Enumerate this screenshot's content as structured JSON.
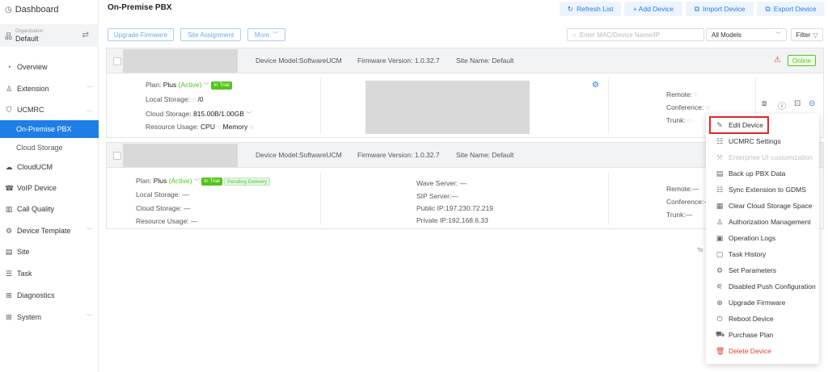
{
  "sidebar": {
    "dashboard": "Dashboard",
    "org_label": "Organization",
    "org_value": "Default",
    "items": [
      {
        "label": "Overview",
        "icon": "clock-icon"
      },
      {
        "label": "Extension",
        "icon": "user-icon"
      },
      {
        "label": "UCMRC",
        "icon": "shield-icon"
      },
      {
        "label": "On-Premise PBX"
      },
      {
        "label": "Cloud Storage"
      },
      {
        "label": "CloudUCM",
        "icon": "cloud-icon"
      },
      {
        "label": "VoIP Device",
        "icon": "phone-icon"
      },
      {
        "label": "Call Quality",
        "icon": "bar-chart-icon"
      },
      {
        "label": "Device Template",
        "icon": "template-icon"
      },
      {
        "label": "Site",
        "icon": "site-icon"
      },
      {
        "label": "Task",
        "icon": "task-icon"
      },
      {
        "label": "Diagnostics",
        "icon": "diagnostics-icon"
      },
      {
        "label": "System",
        "icon": "system-icon"
      }
    ]
  },
  "header": {
    "title": "On-Premise PBX",
    "refresh": "Refresh List",
    "add": "+ Add Device",
    "import": "Import Device",
    "export": "Export Device"
  },
  "toolbar": {
    "upgrade": "Upgrade Firmware",
    "site": "Site Assignment",
    "more": "More",
    "search_placeholder": "Enter MAC/Device Name/IP",
    "models": "All Models",
    "filter": "Filter"
  },
  "devices": [
    {
      "model": "Device Model:SoftwareUCM",
      "firmware": "Firmware Version: 1.0.32.7",
      "site": "Site Name: Default",
      "status": "Online",
      "plan_label": "Plan:",
      "plan_value": "Plus",
      "plan_state": "(Active)",
      "trial": "In Trial",
      "local_storage": "Local Storage:",
      "local_value": "/0",
      "cloud_storage": "Cloud Storage:",
      "cloud_value": "815.00B/1.00GB",
      "resource": "Resource Usage:",
      "cpu": "CPU",
      "memory": "Memory",
      "remote": "Remote:",
      "conference": "Conference:",
      "trunk": "Trunk:"
    },
    {
      "model": "Device Model:SoftwareUCM",
      "firmware": "Firmware Version: 1.0.32.7",
      "site": "Site Name: Default",
      "plan_label": "Plan:",
      "plan_value": "Plus",
      "plan_state": "(Active)",
      "trial": "In Trial",
      "pending": "Pending Delivery",
      "local_storage": "Local Storage: —",
      "cloud_storage": "Cloud Storage: —",
      "resource": "Resource Usage: —",
      "wave": "Wave Server: —",
      "sip": "SIP Server:—",
      "public_ip": "Public IP:197.230.72.219",
      "private_ip": "Private IP:192.168.6.33",
      "remote": "Remote:—",
      "conference": "Conference:—",
      "trunk": "Trunk:—"
    }
  ],
  "total_label": "To",
  "menu": [
    {
      "label": "Edit Device",
      "icon": "edit-icon"
    },
    {
      "label": "UCMRC Settings",
      "icon": "settings-sliders-icon"
    },
    {
      "label": "Enterprise UI customization",
      "icon": "ui-customize-icon",
      "disabled": true
    },
    {
      "label": "Back up PBX Data",
      "icon": "backup-icon"
    },
    {
      "label": "Sync Extension to GDMS",
      "icon": "sync-icon"
    },
    {
      "label": "Clear Cloud Storage Space",
      "icon": "clear-storage-icon"
    },
    {
      "label": "Authorization Management",
      "icon": "user-key-icon"
    },
    {
      "label": "Operation Logs",
      "icon": "log-icon"
    },
    {
      "label": "Task History",
      "icon": "history-icon"
    },
    {
      "label": "Set Parameters",
      "icon": "gear-icon"
    },
    {
      "label": "Disabled Push Configuration",
      "icon": "push-icon"
    },
    {
      "label": "Upgrade Firmware",
      "icon": "upgrade-icon"
    },
    {
      "label": "Reboot Device",
      "icon": "power-icon"
    },
    {
      "label": "Purchase Plan",
      "icon": "cart-icon"
    },
    {
      "label": "Delete Device",
      "icon": "trash-icon",
      "danger": true
    }
  ],
  "colors": {
    "accent": "#1e7ee5",
    "online": "#52c41a",
    "danger": "#e53935"
  }
}
